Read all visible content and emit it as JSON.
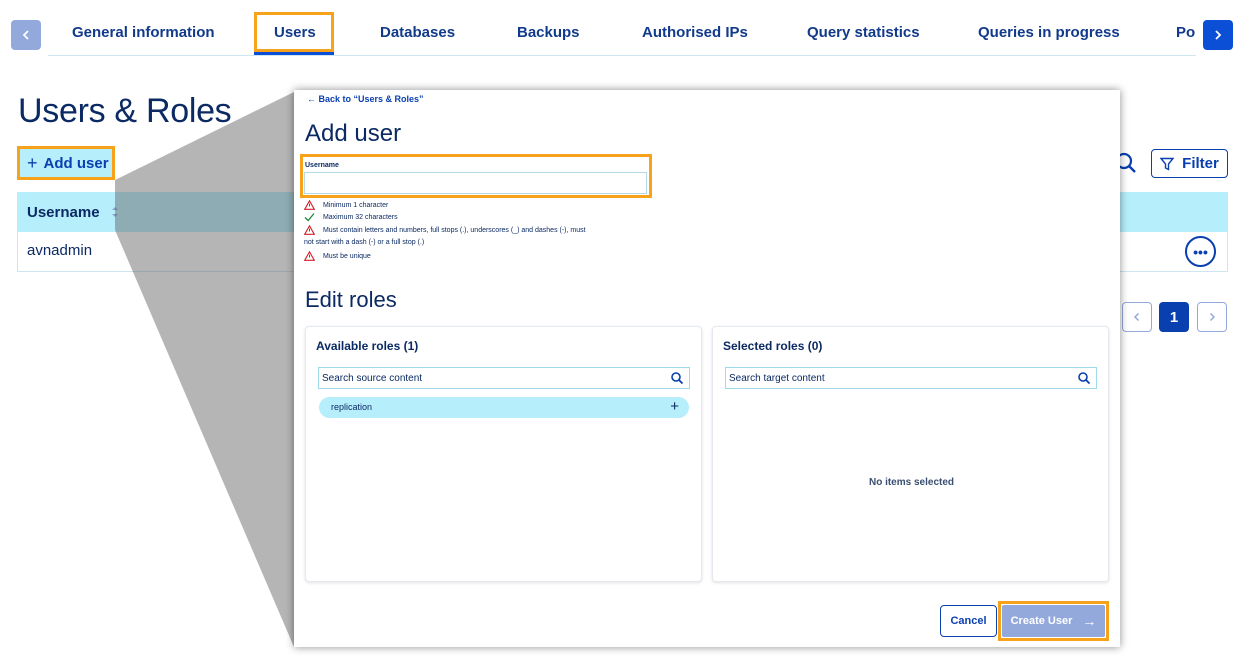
{
  "tabs": [
    {
      "label": "General information"
    },
    {
      "label": "Users"
    },
    {
      "label": "Databases"
    },
    {
      "label": "Backups"
    },
    {
      "label": "Authorised IPs"
    },
    {
      "label": "Query statistics"
    },
    {
      "label": "Queries in progress"
    },
    {
      "label": "Po"
    }
  ],
  "active_tab": "Users",
  "page": {
    "title": "Users & Roles",
    "add_user_label": "Add user",
    "filter_label": "Filter",
    "table": {
      "columns": [
        "Username"
      ],
      "rows": [
        [
          "avnadmin"
        ]
      ]
    },
    "row_menu_glyph": "•••",
    "pagination": {
      "current": "1"
    }
  },
  "modal": {
    "back_link": "← Back to “Users & Roles”",
    "title": "Add user",
    "username_label": "Username",
    "username_value": "",
    "rules": [
      {
        "text": "Minimum 1 character",
        "status": "warning"
      },
      {
        "text": "Maximum 32 characters",
        "status": "ok"
      },
      {
        "text": "Must contain letters and numbers, full stops (.), underscores (_) and dashes (-), must",
        "status": "warning"
      },
      {
        "text": "not start with a dash (-) or a full stop (.)",
        "status": "continuation"
      },
      {
        "text": "Must be unique",
        "status": "warning"
      }
    ],
    "edit_roles_title": "Edit roles",
    "available": {
      "title": "Available roles (1)",
      "search_placeholder": "Search source content",
      "items": [
        "replication"
      ]
    },
    "selected": {
      "title": "Selected roles (0)",
      "search_placeholder": "Search target content",
      "empty_text": "No items selected"
    },
    "cancel_label": "Cancel",
    "create_label": "Create User"
  },
  "colors": {
    "highlight": "#f7a21b",
    "primary": "#0a3fb0",
    "header_bg": "#b6eefc",
    "text": "#0b2a63",
    "warning": "#d3222a",
    "ok": "#1f8a3b"
  }
}
